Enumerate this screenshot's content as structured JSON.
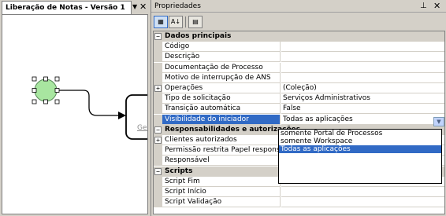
{
  "designer": {
    "tab_title": "Liberação de Notas - Versão 1",
    "activity_label": "Ges"
  },
  "properties": {
    "title": "Propriedades",
    "categories": [
      {
        "label": "Dados principais",
        "expanded": true,
        "rows": [
          {
            "name": "Código",
            "value": ""
          },
          {
            "name": "Descrição",
            "value": ""
          },
          {
            "name": "Documentação de Processo",
            "value": ""
          },
          {
            "name": "Motivo de interrupção de ANS",
            "value": ""
          },
          {
            "name": "Operações",
            "value": "(Coleção)",
            "expandable": true
          },
          {
            "name": "Tipo de solicitação",
            "value": "Serviços Administrativos"
          },
          {
            "name": "Transição automática",
            "value": "False"
          },
          {
            "name": "Visibilidade do iniciador",
            "value": "Todas as aplicações",
            "selected": true
          }
        ]
      },
      {
        "label": "Responsabilidades e autorizações",
        "expanded": true,
        "rows": [
          {
            "name": "Clientes autorizados",
            "value": "",
            "expandable": true
          },
          {
            "name": "Permissão restrita Papel responsável",
            "value": ""
          },
          {
            "name": "Responsável",
            "value": ""
          }
        ]
      },
      {
        "label": "Scripts",
        "expanded": true,
        "rows": [
          {
            "name": "Script Fim",
            "value": ""
          },
          {
            "name": "Script Início",
            "value": ""
          },
          {
            "name": "Script Validação",
            "value": ""
          }
        ]
      }
    ],
    "dropdown_options": [
      {
        "label": "somente Portal de Processos",
        "active": false
      },
      {
        "label": "somente Workspace",
        "active": false
      },
      {
        "label": "Todas as aplicações",
        "active": true
      }
    ]
  },
  "colors": {
    "selection": "#316ac5",
    "chrome": "#d4d0c8",
    "start_event_fill": "#a8e6a0"
  }
}
